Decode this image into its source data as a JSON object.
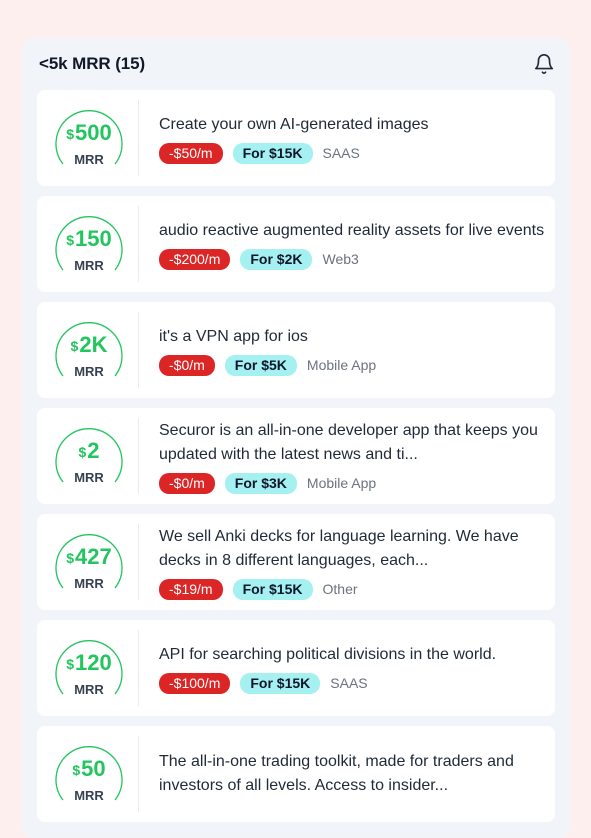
{
  "header": {
    "title": "<5k MRR (15)",
    "bell_icon": "bell-icon"
  },
  "colors": {
    "mrr_green": "#22c55e",
    "price_red": "#dc2626",
    "sale_cyan": "#a5f0f0"
  },
  "listings": [
    {
      "currency": "$",
      "amount": "500",
      "mrr_label": "MRR",
      "description": "Create your own AI-generated images",
      "price": "-$50/m",
      "sale": "For $15K",
      "category": "SAAS"
    },
    {
      "currency": "$",
      "amount": "150",
      "mrr_label": "MRR",
      "description": "audio reactive augmented reality assets for live events",
      "price": "-$200/m",
      "sale": "For $2K",
      "category": "Web3"
    },
    {
      "currency": "$",
      "amount": "2K",
      "mrr_label": "MRR",
      "description": "it's a VPN app for ios",
      "price": "-$0/m",
      "sale": "For $5K",
      "category": "Mobile App"
    },
    {
      "currency": "$",
      "amount": "2",
      "mrr_label": "MRR",
      "description": "Securor is an all-in-one developer app that keeps you updated with the latest news and ti...",
      "price": "-$0/m",
      "sale": "For $3K",
      "category": "Mobile App"
    },
    {
      "currency": "$",
      "amount": "427",
      "mrr_label": "MRR",
      "description": "We sell Anki decks for language learning. We have decks in 8 different languages, each...",
      "price": "-$19/m",
      "sale": "For $15K",
      "category": "Other"
    },
    {
      "currency": "$",
      "amount": "120",
      "mrr_label": "MRR",
      "description": "API for searching political divisions in the world.",
      "price": "-$100/m",
      "sale": "For $15K",
      "category": "SAAS"
    },
    {
      "currency": "$",
      "amount": "50",
      "mrr_label": "MRR",
      "description": "The all-in-one trading toolkit, made for traders and investors of all levels. Access to insider...",
      "price": "",
      "sale": "",
      "category": ""
    }
  ]
}
